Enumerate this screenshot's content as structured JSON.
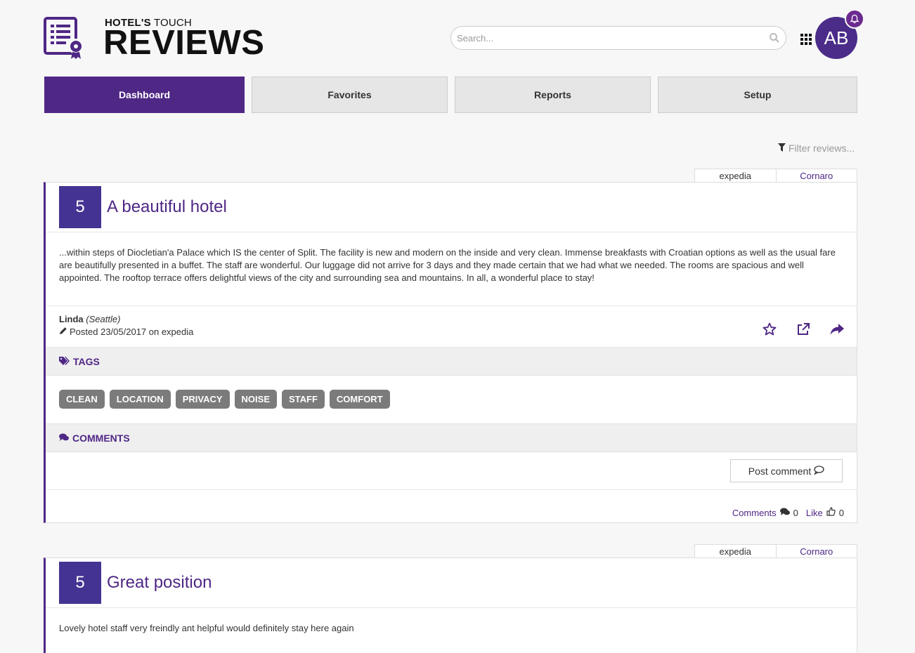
{
  "brand": {
    "top_bold": "HOTEL'S",
    "top_rest": " TOUCH",
    "main": "REVIEWS"
  },
  "search": {
    "placeholder": "Search..."
  },
  "user": {
    "initials": "AB"
  },
  "nav": {
    "dashboard": "Dashboard",
    "favorites": "Favorites",
    "reports": "Reports",
    "setup": "Setup"
  },
  "filter": {
    "label": "Filter reviews..."
  },
  "colors": {
    "accent": "#4f2785",
    "score_bg": "#453393",
    "tag_bg": "#7b7b7b"
  },
  "reviews": [
    {
      "source": "expedia",
      "hotel": "Cornaro",
      "score": "5",
      "title": "A beautiful hotel",
      "text": "...within steps of Diocletian'a Palace which IS the center of Split. The facility is new and modern on the inside and very clean. Immense breakfasts with Croatian options as well as the usual fare are beautifully presented in a buffet. The staff are wonderful. Our luggage did not arrive for 3 days and they made certain that we had what we needed. The rooms are spacious and well appointed. The rooftop terrace offers delightful views of the city and surrounding sea and mountains. In all, a wonderful place to stay!",
      "author": "Linda",
      "location": "(Seattle)",
      "posted": "Posted 23/05/2017 on expedia",
      "tags_heading": "TAGS",
      "tags": [
        "CLEAN",
        "LOCATION",
        "PRIVACY",
        "NOISE",
        "STAFF",
        "COMFORT"
      ],
      "comments_heading": "COMMENTS",
      "post_comment": "Post comment",
      "comments_label": "Comments",
      "comments_count": "0",
      "like_label": "Like",
      "like_count": "0"
    },
    {
      "source": "expedia",
      "hotel": "Cornaro",
      "score": "5",
      "title": "Great position",
      "text": "Lovely hotel staff very freindly ant helpful would definitely stay here again"
    }
  ]
}
